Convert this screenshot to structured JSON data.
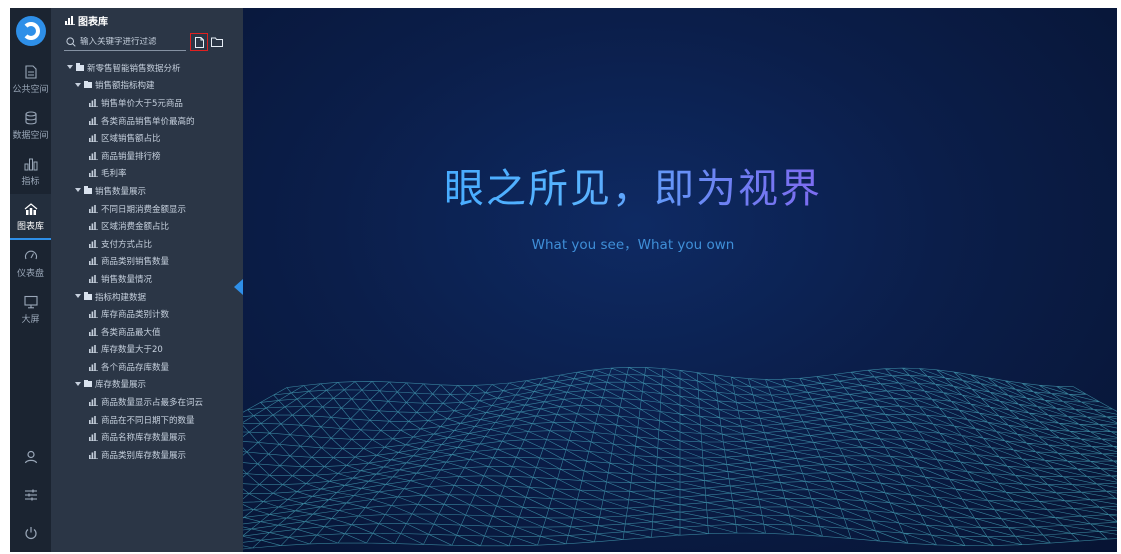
{
  "rail": {
    "items": [
      {
        "label": "公共空间",
        "icon": "document-icon",
        "active": false
      },
      {
        "label": "数据空间",
        "icon": "database-icon",
        "active": false
      },
      {
        "label": "指标",
        "icon": "bar-chart-icon",
        "active": false
      },
      {
        "label": "图表库",
        "icon": "chart-library-icon",
        "active": true
      },
      {
        "label": "仪表盘",
        "icon": "gauge-icon",
        "active": false
      },
      {
        "label": "大屏",
        "icon": "monitor-icon",
        "active": false
      }
    ],
    "bottom": [
      "user-icon",
      "sliders-icon",
      "power-icon"
    ]
  },
  "tree": {
    "title": "图表库",
    "search_placeholder": "输入关键字进行过滤",
    "nodes": [
      {
        "label": "新零售智能销售数据分析",
        "level": 0,
        "type": "folder"
      },
      {
        "label": "销售额指标构建",
        "level": 1,
        "type": "folder"
      },
      {
        "label": "销售单价大于5元商品",
        "level": 2,
        "type": "chart"
      },
      {
        "label": "各类商品销售单价最高的",
        "level": 2,
        "type": "chart"
      },
      {
        "label": "区域销售额占比",
        "level": 2,
        "type": "chart"
      },
      {
        "label": "商品销量排行榜",
        "level": 2,
        "type": "chart"
      },
      {
        "label": "毛利率",
        "level": 2,
        "type": "chart"
      },
      {
        "label": "销售数量展示",
        "level": 1,
        "type": "folder"
      },
      {
        "label": "不同日期消费金额显示",
        "level": 2,
        "type": "chart"
      },
      {
        "label": "区域消费金额占比",
        "level": 2,
        "type": "chart"
      },
      {
        "label": "支付方式占比",
        "level": 2,
        "type": "chart"
      },
      {
        "label": "商品类别销售数量",
        "level": 2,
        "type": "chart"
      },
      {
        "label": "销售数量情况",
        "level": 2,
        "type": "chart"
      },
      {
        "label": "指标构建数据",
        "level": 1,
        "type": "folder"
      },
      {
        "label": "库存商品类别计数",
        "level": 2,
        "type": "chart"
      },
      {
        "label": "各类商品最大值",
        "level": 2,
        "type": "chart"
      },
      {
        "label": "库存数量大于20",
        "level": 2,
        "type": "chart"
      },
      {
        "label": "各个商品存库数量",
        "level": 2,
        "type": "chart"
      },
      {
        "label": "库存数量展示",
        "level": 1,
        "type": "folder"
      },
      {
        "label": "商品数量显示占最多在词云",
        "level": 2,
        "type": "chart"
      },
      {
        "label": "商品在不同日期下的数量",
        "level": 2,
        "type": "chart"
      },
      {
        "label": "商品名称库存数量展示",
        "level": 2,
        "type": "chart"
      },
      {
        "label": "商品类别库存数量展示",
        "level": 2,
        "type": "chart"
      }
    ]
  },
  "hero": {
    "title": "眼之所见，即为视界",
    "subtitle": "What you see，What you own"
  },
  "colors": {
    "accent": "#2e8fe8",
    "highlight_box": "#e02020",
    "rail_bg": "#1b2431",
    "tree_bg": "#2b3646"
  }
}
